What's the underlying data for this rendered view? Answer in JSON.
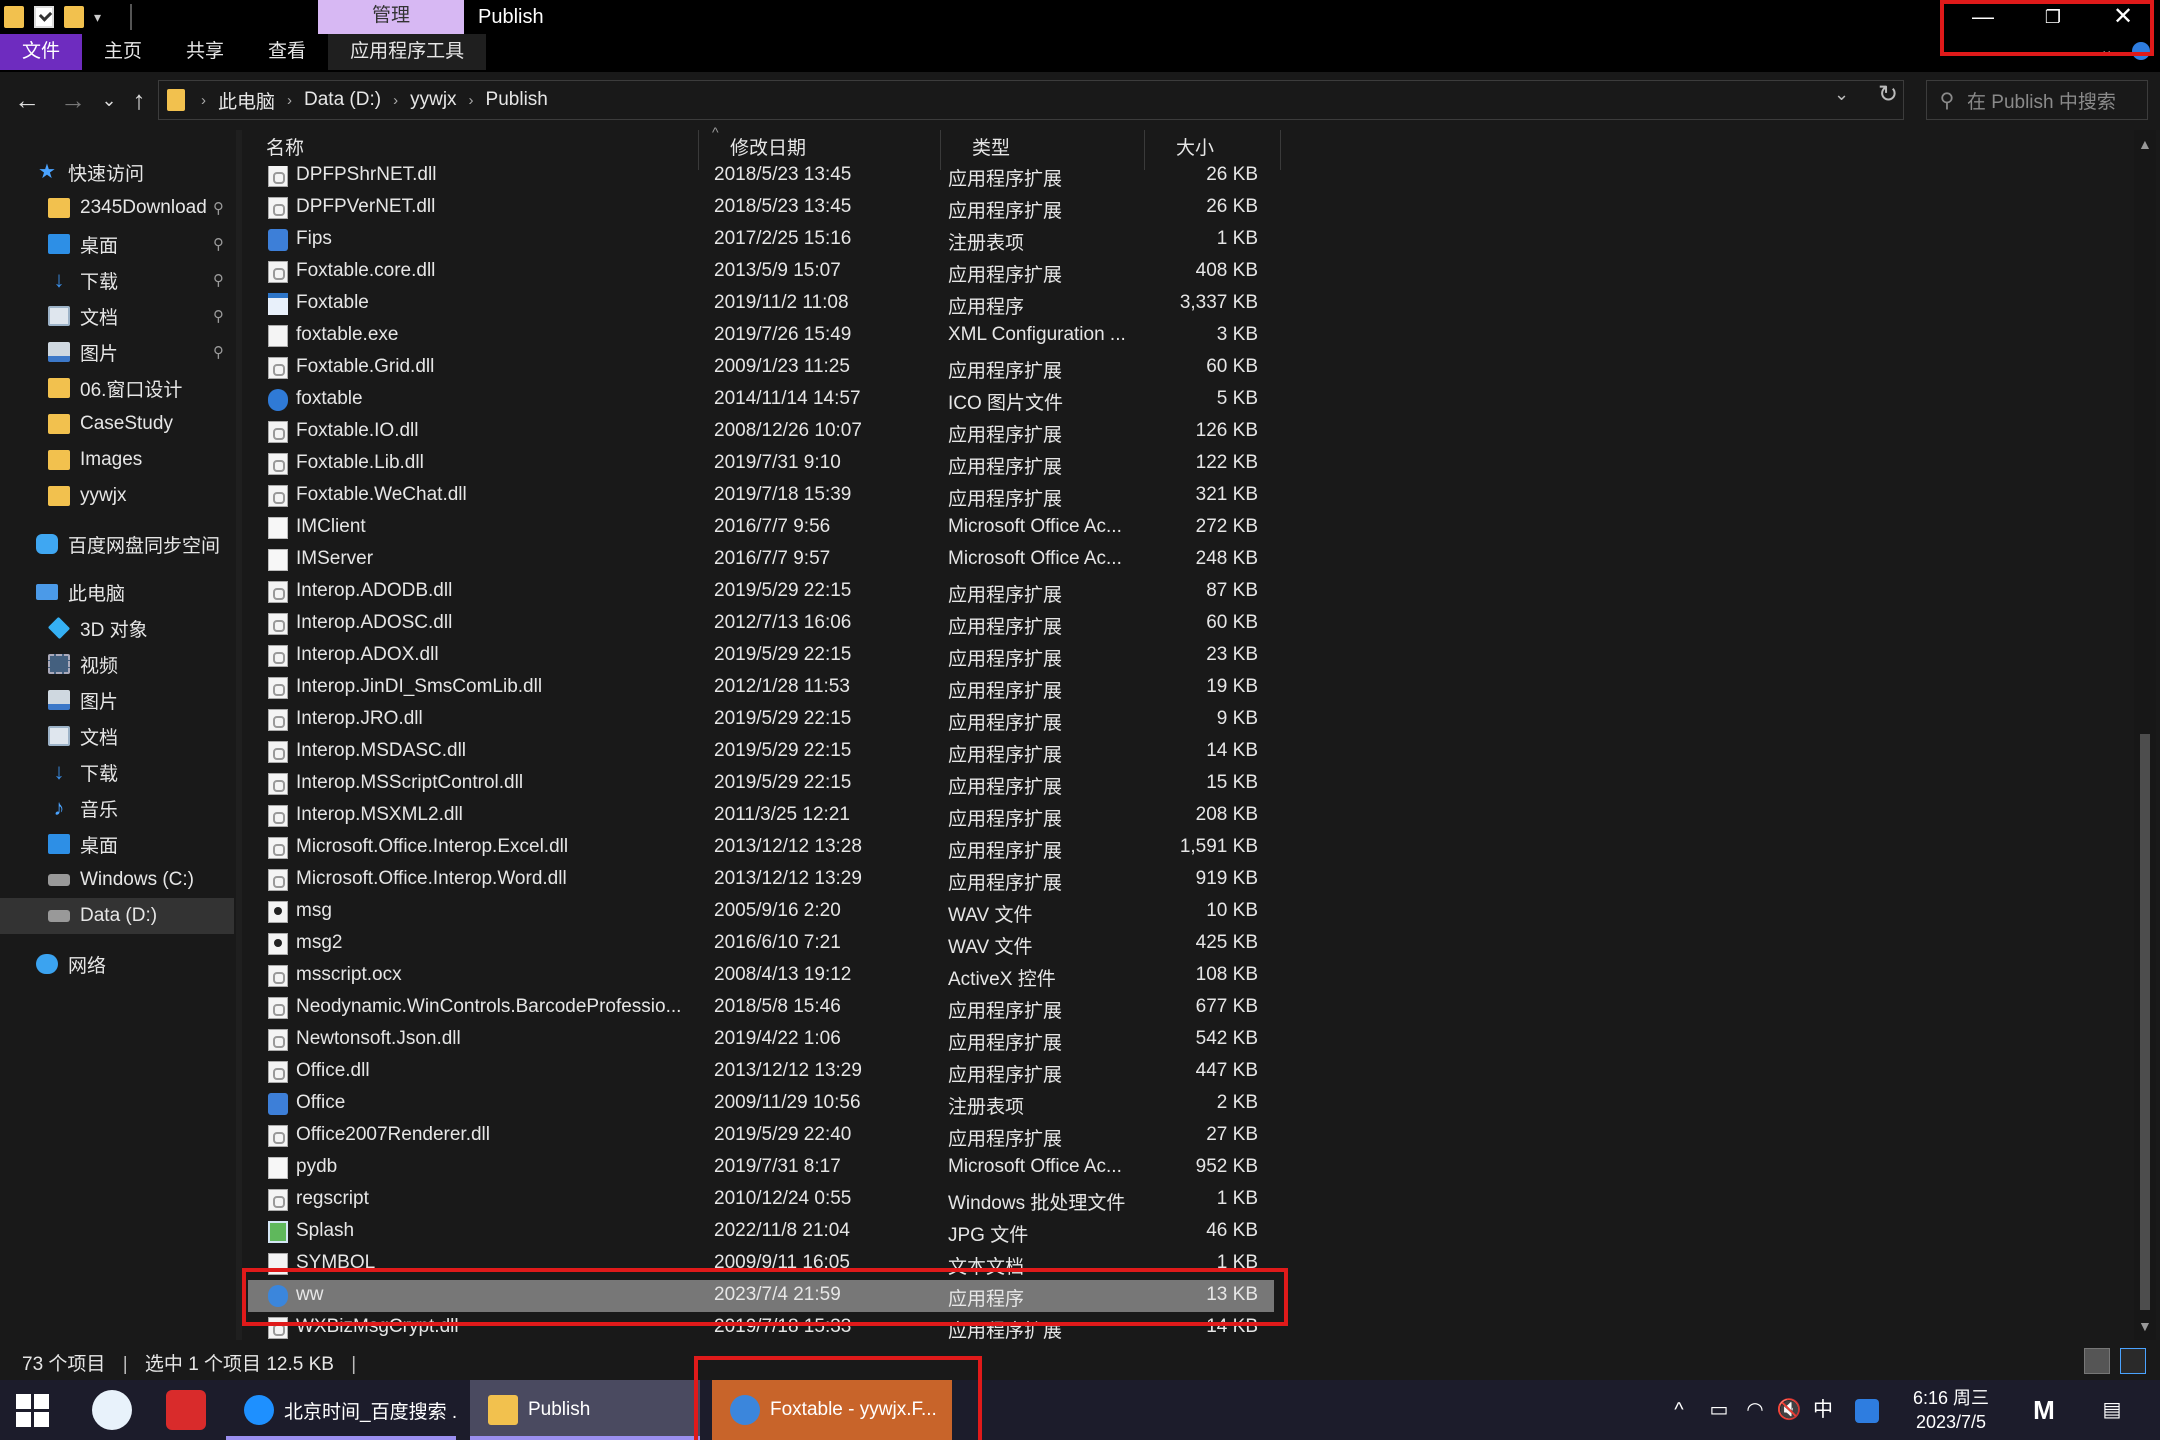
{
  "title_bar": {
    "contextual_tab": "管理",
    "window_title": "Publish",
    "controls": {
      "minimize": "—",
      "maximize": "❐",
      "close": "✕"
    }
  },
  "ribbon": {
    "tabs": [
      "文件",
      "主页",
      "共享",
      "查看",
      "应用程序工具"
    ],
    "file_tab_color": "#6e2cbf",
    "contextual_color": "#d7b8f3"
  },
  "address_bar": {
    "breadcrumbs": [
      "此电脑",
      "Data (D:)",
      "yywjx",
      "Publish"
    ],
    "search_placeholder": "在 Publish 中搜索"
  },
  "nav_pane": {
    "items": [
      {
        "label": "快速访问",
        "icon": "star-icon",
        "pinned": false
      },
      {
        "label": "2345Download",
        "icon": "folder-icon",
        "pinned": true
      },
      {
        "label": "桌面",
        "icon": "desktop-icon",
        "pinned": true
      },
      {
        "label": "下载",
        "icon": "download-icon",
        "pinned": true
      },
      {
        "label": "文档",
        "icon": "document-icon",
        "pinned": true
      },
      {
        "label": "图片",
        "icon": "pictures-icon",
        "pinned": true
      },
      {
        "label": "06.窗口设计",
        "icon": "folder-icon",
        "pinned": false
      },
      {
        "label": "CaseStudy",
        "icon": "folder-icon",
        "pinned": false
      },
      {
        "label": "Images",
        "icon": "folder-icon",
        "pinned": false
      },
      {
        "label": "yywjx",
        "icon": "folder-icon",
        "pinned": false
      },
      {
        "label": "百度网盘同步空间",
        "icon": "cloud-sync-icon",
        "pinned": false
      },
      {
        "label": "此电脑",
        "icon": "computer-icon",
        "pinned": false
      },
      {
        "label": "3D 对象",
        "icon": "3d-objects-icon",
        "pinned": false
      },
      {
        "label": "视频",
        "icon": "video-icon",
        "pinned": false
      },
      {
        "label": "图片",
        "icon": "pictures-icon",
        "pinned": false
      },
      {
        "label": "文档",
        "icon": "document-icon",
        "pinned": false
      },
      {
        "label": "下载",
        "icon": "download-icon",
        "pinned": false
      },
      {
        "label": "音乐",
        "icon": "music-icon",
        "pinned": false
      },
      {
        "label": "桌面",
        "icon": "desktop-icon",
        "pinned": false
      },
      {
        "label": "Windows (C:)",
        "icon": "drive-icon",
        "pinned": false
      },
      {
        "label": "Data (D:)",
        "icon": "drive-icon",
        "pinned": false,
        "selected": true
      },
      {
        "label": "网络",
        "icon": "network-icon",
        "pinned": false
      }
    ],
    "pin_glyph": "📌"
  },
  "columns": {
    "name": "名称",
    "date": "修改日期",
    "type": "类型",
    "size": "大小"
  },
  "files": [
    {
      "name": "DPFPShrNET.dll",
      "date": "2018/5/23 13:45",
      "type": "应用程序扩展",
      "size": "26 KB",
      "icon": "dll"
    },
    {
      "name": "DPFPVerNET.dll",
      "date": "2018/5/23 13:45",
      "type": "应用程序扩展",
      "size": "26 KB",
      "icon": "dll"
    },
    {
      "name": "Fips",
      "date": "2017/2/25 15:16",
      "type": "注册表项",
      "size": "1 KB",
      "icon": "reg"
    },
    {
      "name": "Foxtable.core.dll",
      "date": "2013/5/9 15:07",
      "type": "应用程序扩展",
      "size": "408 KB",
      "icon": "dll"
    },
    {
      "name": "Foxtable",
      "date": "2019/11/2 11:08",
      "type": "应用程序",
      "size": "3,337 KB",
      "icon": "exe"
    },
    {
      "name": "foxtable.exe",
      "date": "2019/7/26 15:49",
      "type": "XML Configuration ...",
      "size": "3 KB",
      "icon": "xml"
    },
    {
      "name": "Foxtable.Grid.dll",
      "date": "2009/1/23 11:25",
      "type": "应用程序扩展",
      "size": "60 KB",
      "icon": "dll"
    },
    {
      "name": "foxtable",
      "date": "2014/11/14 14:57",
      "type": "ICO 图片文件",
      "size": "5 KB",
      "icon": "ico"
    },
    {
      "name": "Foxtable.IO.dll",
      "date": "2008/12/26 10:07",
      "type": "应用程序扩展",
      "size": "126 KB",
      "icon": "dll"
    },
    {
      "name": "Foxtable.Lib.dll",
      "date": "2019/7/31 9:10",
      "type": "应用程序扩展",
      "size": "122 KB",
      "icon": "dll"
    },
    {
      "name": "Foxtable.WeChat.dll",
      "date": "2019/7/18 15:39",
      "type": "应用程序扩展",
      "size": "321 KB",
      "icon": "dll"
    },
    {
      "name": "IMClient",
      "date": "2016/7/7 9:56",
      "type": "Microsoft Office Ac...",
      "size": "272 KB",
      "icon": "blank"
    },
    {
      "name": "IMServer",
      "date": "2016/7/7 9:57",
      "type": "Microsoft Office Ac...",
      "size": "248 KB",
      "icon": "blank"
    },
    {
      "name": "Interop.ADODB.dll",
      "date": "2019/5/29 22:15",
      "type": "应用程序扩展",
      "size": "87 KB",
      "icon": "dll"
    },
    {
      "name": "Interop.ADOSC.dll",
      "date": "2012/7/13 16:06",
      "type": "应用程序扩展",
      "size": "60 KB",
      "icon": "dll"
    },
    {
      "name": "Interop.ADOX.dll",
      "date": "2019/5/29 22:15",
      "type": "应用程序扩展",
      "size": "23 KB",
      "icon": "dll"
    },
    {
      "name": "Interop.JinDI_SmsComLib.dll",
      "date": "2012/1/28 11:53",
      "type": "应用程序扩展",
      "size": "19 KB",
      "icon": "dll"
    },
    {
      "name": "Interop.JRO.dll",
      "date": "2019/5/29 22:15",
      "type": "应用程序扩展",
      "size": "9 KB",
      "icon": "dll"
    },
    {
      "name": "Interop.MSDASC.dll",
      "date": "2019/5/29 22:15",
      "type": "应用程序扩展",
      "size": "14 KB",
      "icon": "dll"
    },
    {
      "name": "Interop.MSScriptControl.dll",
      "date": "2019/5/29 22:15",
      "type": "应用程序扩展",
      "size": "15 KB",
      "icon": "dll"
    },
    {
      "name": "Interop.MSXML2.dll",
      "date": "2011/3/25 12:21",
      "type": "应用程序扩展",
      "size": "208 KB",
      "icon": "dll"
    },
    {
      "name": "Microsoft.Office.Interop.Excel.dll",
      "date": "2013/12/12 13:28",
      "type": "应用程序扩展",
      "size": "1,591 KB",
      "icon": "dll"
    },
    {
      "name": "Microsoft.Office.Interop.Word.dll",
      "date": "2013/12/12 13:29",
      "type": "应用程序扩展",
      "size": "919 KB",
      "icon": "dll"
    },
    {
      "name": "msg",
      "date": "2005/9/16 2:20",
      "type": "WAV 文件",
      "size": "10 KB",
      "icon": "wav"
    },
    {
      "name": "msg2",
      "date": "2016/6/10 7:21",
      "type": "WAV 文件",
      "size": "425 KB",
      "icon": "wav"
    },
    {
      "name": "msscript.ocx",
      "date": "2008/4/13 19:12",
      "type": "ActiveX 控件",
      "size": "108 KB",
      "icon": "dll"
    },
    {
      "name": "Neodynamic.WinControls.BarcodeProfessio...",
      "date": "2018/5/8 15:46",
      "type": "应用程序扩展",
      "size": "677 KB",
      "icon": "dll"
    },
    {
      "name": "Newtonsoft.Json.dll",
      "date": "2019/4/22 1:06",
      "type": "应用程序扩展",
      "size": "542 KB",
      "icon": "dll"
    },
    {
      "name": "Office.dll",
      "date": "2013/12/12 13:29",
      "type": "应用程序扩展",
      "size": "447 KB",
      "icon": "dll"
    },
    {
      "name": "Office",
      "date": "2009/11/29 10:56",
      "type": "注册表项",
      "size": "2 KB",
      "icon": "reg"
    },
    {
      "name": "Office2007Renderer.dll",
      "date": "2019/5/29 22:40",
      "type": "应用程序扩展",
      "size": "27 KB",
      "icon": "dll"
    },
    {
      "name": "pydb",
      "date": "2019/7/31 8:17",
      "type": "Microsoft Office Ac...",
      "size": "952 KB",
      "icon": "blank"
    },
    {
      "name": "regscript",
      "date": "2010/12/24 0:55",
      "type": "Windows 批处理文件",
      "size": "1 KB",
      "icon": "dll"
    },
    {
      "name": "Splash",
      "date": "2022/11/8 21:04",
      "type": "JPG 文件",
      "size": "46 KB",
      "icon": "jpg"
    },
    {
      "name": "SYMBOL",
      "date": "2009/9/11 16:05",
      "type": "文本文档",
      "size": "1 KB",
      "icon": "txt"
    },
    {
      "name": "ww",
      "date": "2023/7/4 21:59",
      "type": "应用程序",
      "size": "13 KB",
      "icon": "app",
      "selected": true
    },
    {
      "name": "WXBizMsgCrypt.dll",
      "date": "2019/7/18 15:33",
      "type": "应用程序扩展",
      "size": "14 KB",
      "icon": "dll"
    }
  ],
  "status_bar": {
    "item_count": "73 个项目",
    "selection": "选中 1 个项目  12.5 KB"
  },
  "taskbar": {
    "apps": [
      {
        "label": "北京时间_百度搜索 ...",
        "icon": "edge-icon",
        "color": "#1e90ff"
      },
      {
        "label": "Publish",
        "icon": "folder-icon",
        "color": "#f2c14e"
      },
      {
        "label": "Foxtable - yywjx.F...",
        "icon": "foxtable-icon",
        "color": "#3b86dc"
      }
    ],
    "tray": {
      "expand": "^",
      "ime": "中",
      "time": "6:16 周三",
      "date": "2023/7/5"
    }
  }
}
